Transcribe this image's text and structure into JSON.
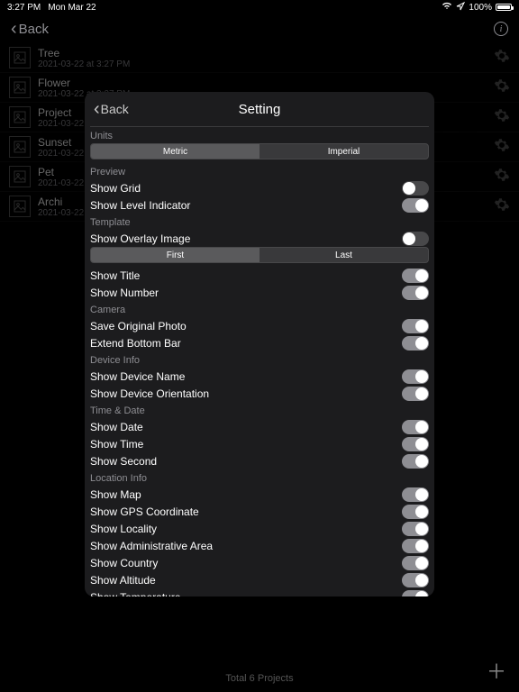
{
  "status": {
    "time": "3:27 PM",
    "date": "Mon Mar 22",
    "battery": "100%"
  },
  "nav": {
    "back": "Back"
  },
  "projects": [
    {
      "name": "Tree",
      "sub": "2021-03-22 at 3:27 PM"
    },
    {
      "name": "Flower",
      "sub": "2021-03-22 at 3:27 PM"
    },
    {
      "name": "Project",
      "sub": "2021-03-22 at"
    },
    {
      "name": "Sunset",
      "sub": "2021-03-22 at"
    },
    {
      "name": "Pet",
      "sub": "2021-03-22 at"
    },
    {
      "name": "Archi",
      "sub": "2021-03-22 at"
    }
  ],
  "footer": {
    "total": "Total 6 Projects"
  },
  "modal": {
    "title": "Setting",
    "back": "Back",
    "sections": {
      "units": "Units",
      "preview": "Preview",
      "template": "Template",
      "camera": "Camera",
      "deviceInfo": "Device Info",
      "timeDate": "Time & Date",
      "locationInfo": "Location Info"
    },
    "segUnits": {
      "a": "Metric",
      "b": "Imperial"
    },
    "segTemplate": {
      "a": "First",
      "b": "Last"
    },
    "rows": {
      "showGrid": "Show Grid",
      "showLevel": "Show Level Indicator",
      "showOverlay": "Show Overlay Image",
      "showTitle": "Show Title",
      "showNumber": "Show Number",
      "saveOriginal": "Save Original Photo",
      "extendBottom": "Extend Bottom Bar",
      "showDeviceName": "Show Device Name",
      "showDeviceOrient": "Show Device Orientation",
      "showDate": "Show Date",
      "showTime": "Show Time",
      "showSecond": "Show Second",
      "showMap": "Show Map",
      "showGPS": "Show GPS Coordinate",
      "showLocality": "Show Locality",
      "showAdmin": "Show Administrative Area",
      "showCountry": "Show Country",
      "showAltitude": "Show Altitude",
      "showTemp": "Show Temperature"
    }
  }
}
